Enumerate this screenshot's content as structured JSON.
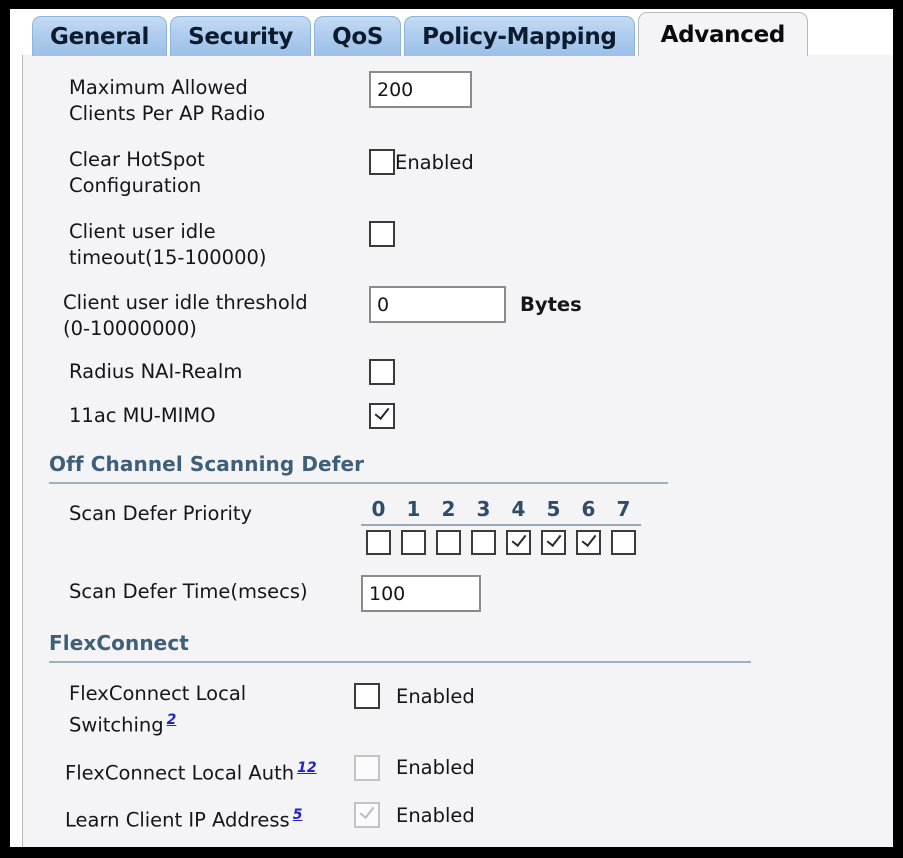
{
  "tabs": [
    {
      "label": "General",
      "active": false
    },
    {
      "label": "Security",
      "active": false
    },
    {
      "label": "QoS",
      "active": false
    },
    {
      "label": "Policy-Mapping",
      "active": false
    },
    {
      "label": "Advanced",
      "active": true
    }
  ],
  "colors": {
    "tab_blue_top": "#c4dbf3",
    "tab_blue_bottom": "#9dc0e8",
    "active_tab_bg": "#f4f3f6",
    "panel_bg": "#f4f3f6",
    "section_heading": "#3f5f79",
    "link_blue": "#2323cc",
    "rule": "#9eb0bd",
    "frame": "#000000"
  },
  "form": {
    "max_clients": {
      "label_line1": "Maximum Allowed",
      "label_line2": "Clients Per AP Radio",
      "value": "200"
    },
    "clear_hotspot": {
      "label_line1": "Clear HotSpot",
      "label_line2": "Configuration",
      "checkbox_label": "Enabled",
      "checked": false,
      "disabled": false
    },
    "client_idle_timeout": {
      "label_line1": "Client user idle",
      "label_line2": "timeout(15-100000)",
      "checked": false,
      "disabled": false
    },
    "client_idle_threshold": {
      "label_line1": "Client user idle threshold",
      "label_line2": "(0-10000000)",
      "value": "0",
      "unit": "Bytes"
    },
    "radius_nai_realm": {
      "label": "Radius NAI-Realm",
      "checked": false,
      "disabled": false
    },
    "mu_mimo": {
      "label": "11ac MU-MIMO",
      "checked": true,
      "disabled": false
    }
  },
  "off_channel": {
    "heading": "Off Channel Scanning Defer",
    "scan_defer_priority": {
      "label": "Scan Defer Priority",
      "numbers": [
        "0",
        "1",
        "2",
        "3",
        "4",
        "5",
        "6",
        "7"
      ],
      "checked": [
        false,
        false,
        false,
        false,
        true,
        true,
        true,
        false
      ]
    },
    "scan_defer_time": {
      "label": "Scan Defer Time(msecs)",
      "value": "100"
    }
  },
  "flexconnect": {
    "heading": "FlexConnect",
    "rows": [
      {
        "label_line1": "FlexConnect Local",
        "label_line2": "Switching",
        "sup": "2",
        "checkbox_label": "Enabled",
        "checked": false,
        "disabled": false
      },
      {
        "label_line1": "FlexConnect Local Auth",
        "label_line2": "",
        "sup": "12",
        "checkbox_label": "Enabled",
        "checked": false,
        "disabled": true
      },
      {
        "label_line1": "Learn Client IP Address",
        "label_line2": "",
        "sup": "5",
        "checkbox_label": "Enabled",
        "checked": true,
        "disabled": true
      }
    ]
  }
}
